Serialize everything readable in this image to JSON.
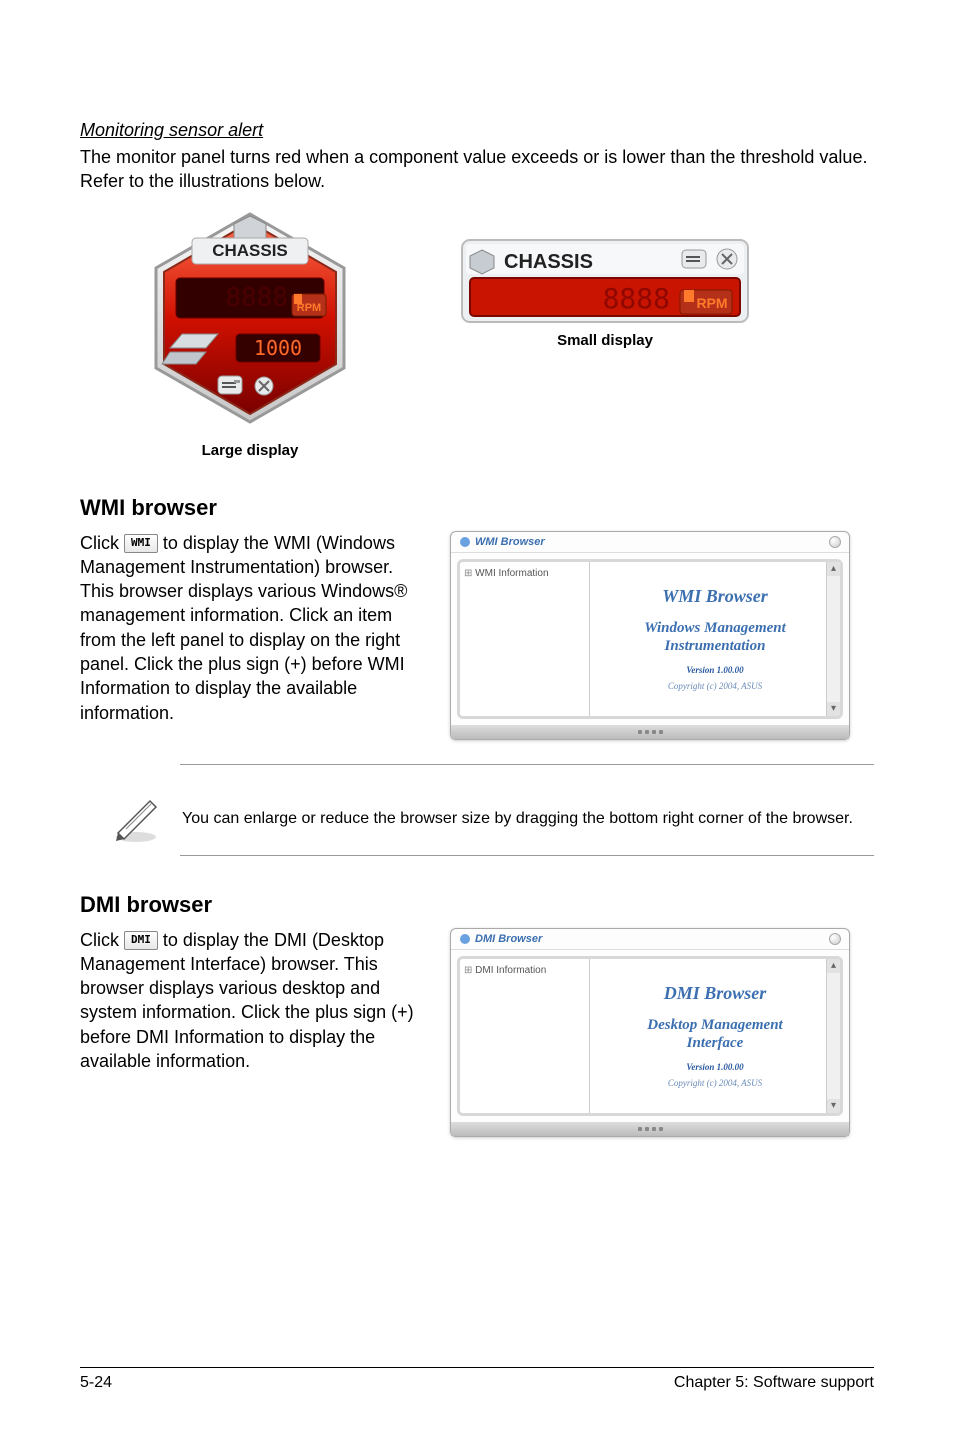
{
  "monitoring": {
    "heading": "Monitoring sensor alert",
    "body": "The monitor panel turns red when a component value exceeds or is lower than the threshold value. Refer to the illustrations below."
  },
  "gauge": {
    "label": "CHASSIS",
    "unit": "RPM",
    "digits_value": "1000",
    "digits_placeholder": "8888",
    "large_caption": "Large display",
    "small_caption": "Small display"
  },
  "wmi": {
    "heading": "WMI browser",
    "click_prefix": "Click ",
    "button_label": "WMI",
    "body": " to display the WMI (Windows Management Instrumentation) browser. This browser displays various Windows® management information. Click an item from the left panel to display on the right panel. Click the plus sign (+) before WMI Information to display the available information.",
    "titlebar": "WMI Browser",
    "tree_root": "WMI Information",
    "pane_title": "WMI Browser",
    "pane_subtitle1": "Windows Management",
    "pane_subtitle2": "Instrumentation",
    "version": "Version 1.00.00",
    "copyright": "Copyright (c) 2004, ASUS"
  },
  "note": {
    "text": "You can enlarge or reduce the browser size by dragging the bottom right corner of the browser."
  },
  "dmi": {
    "heading": "DMI browser",
    "click_prefix": "Click ",
    "button_label": "DMI",
    "body": " to display the DMI (Desktop Management Interface) browser. This browser displays various desktop and system information. Click the plus sign (+) before DMI Information to display the available information.",
    "titlebar": "DMI Browser",
    "tree_root": "DMI Information",
    "pane_title": "DMI Browser",
    "pane_subtitle1": "Desktop Management",
    "pane_subtitle2": "Interface",
    "version": "Version 1.00.00",
    "copyright": "Copyright (c) 2004, ASUS"
  },
  "footer": {
    "left": "5-24",
    "right": "Chapter 5: Software support"
  }
}
